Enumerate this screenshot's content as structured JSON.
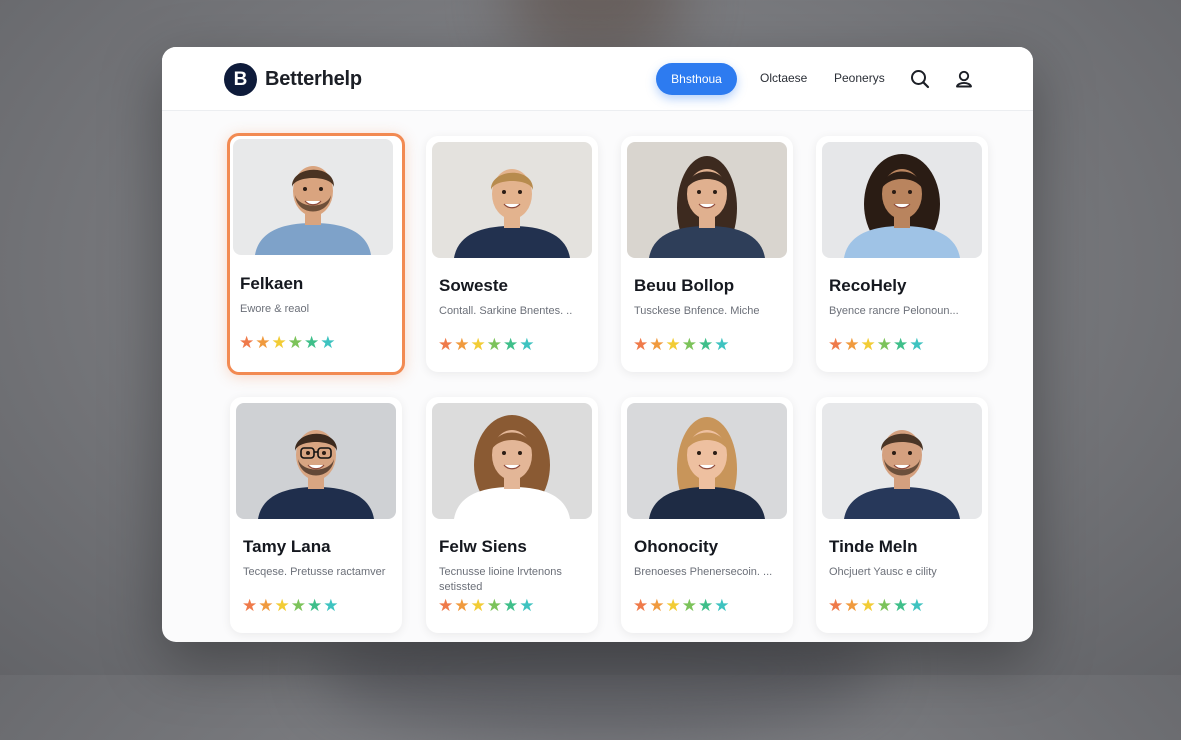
{
  "brand": {
    "initial": "B",
    "name": "Betterhelp"
  },
  "nav": {
    "active_label": "Bhsthoua",
    "links": [
      "Olctaese",
      "Peonerys"
    ],
    "icons": [
      "search-icon",
      "user-icon"
    ]
  },
  "colors": {
    "accent": "#2d7bf0",
    "selected_border": "#f28a52",
    "brand_dark": "#0e1b3a",
    "star_colors": [
      "#ef7a4a",
      "#f09a3e",
      "#f2cc35",
      "#7cc35a",
      "#3fbf8a",
      "#3ec3c0"
    ]
  },
  "therapists": [
    {
      "name": "Felkaen",
      "subtitle": "Ewore & reaol",
      "rating_stars": 6,
      "selected": true
    },
    {
      "name": "Soweste",
      "subtitle": "Contall. Sarkine Bnentes. ..",
      "rating_stars": 6,
      "selected": false
    },
    {
      "name": "Beuu Bollop",
      "subtitle": "Tusckese Bnfence. Miche",
      "rating_stars": 6,
      "selected": false
    },
    {
      "name": "RecoHely",
      "subtitle": "Byence rancre Pelonoun...",
      "rating_stars": 6,
      "selected": false
    },
    {
      "name": "Tamy Lana",
      "subtitle": "Tecqese. Pretusse ractamver",
      "rating_stars": 6,
      "selected": false
    },
    {
      "name": "Felw Siens",
      "subtitle": "Tecnusse lioine lrvtenons setissted",
      "rating_stars": 6,
      "selected": false
    },
    {
      "name": "Ohonocity",
      "subtitle": "Brenoeses Phenersecoin. ...",
      "rating_stars": 6,
      "selected": false
    },
    {
      "name": "Tinde Meln",
      "subtitle": "Ohcjuert Yausc e cility",
      "rating_stars": 6,
      "selected": false
    }
  ]
}
